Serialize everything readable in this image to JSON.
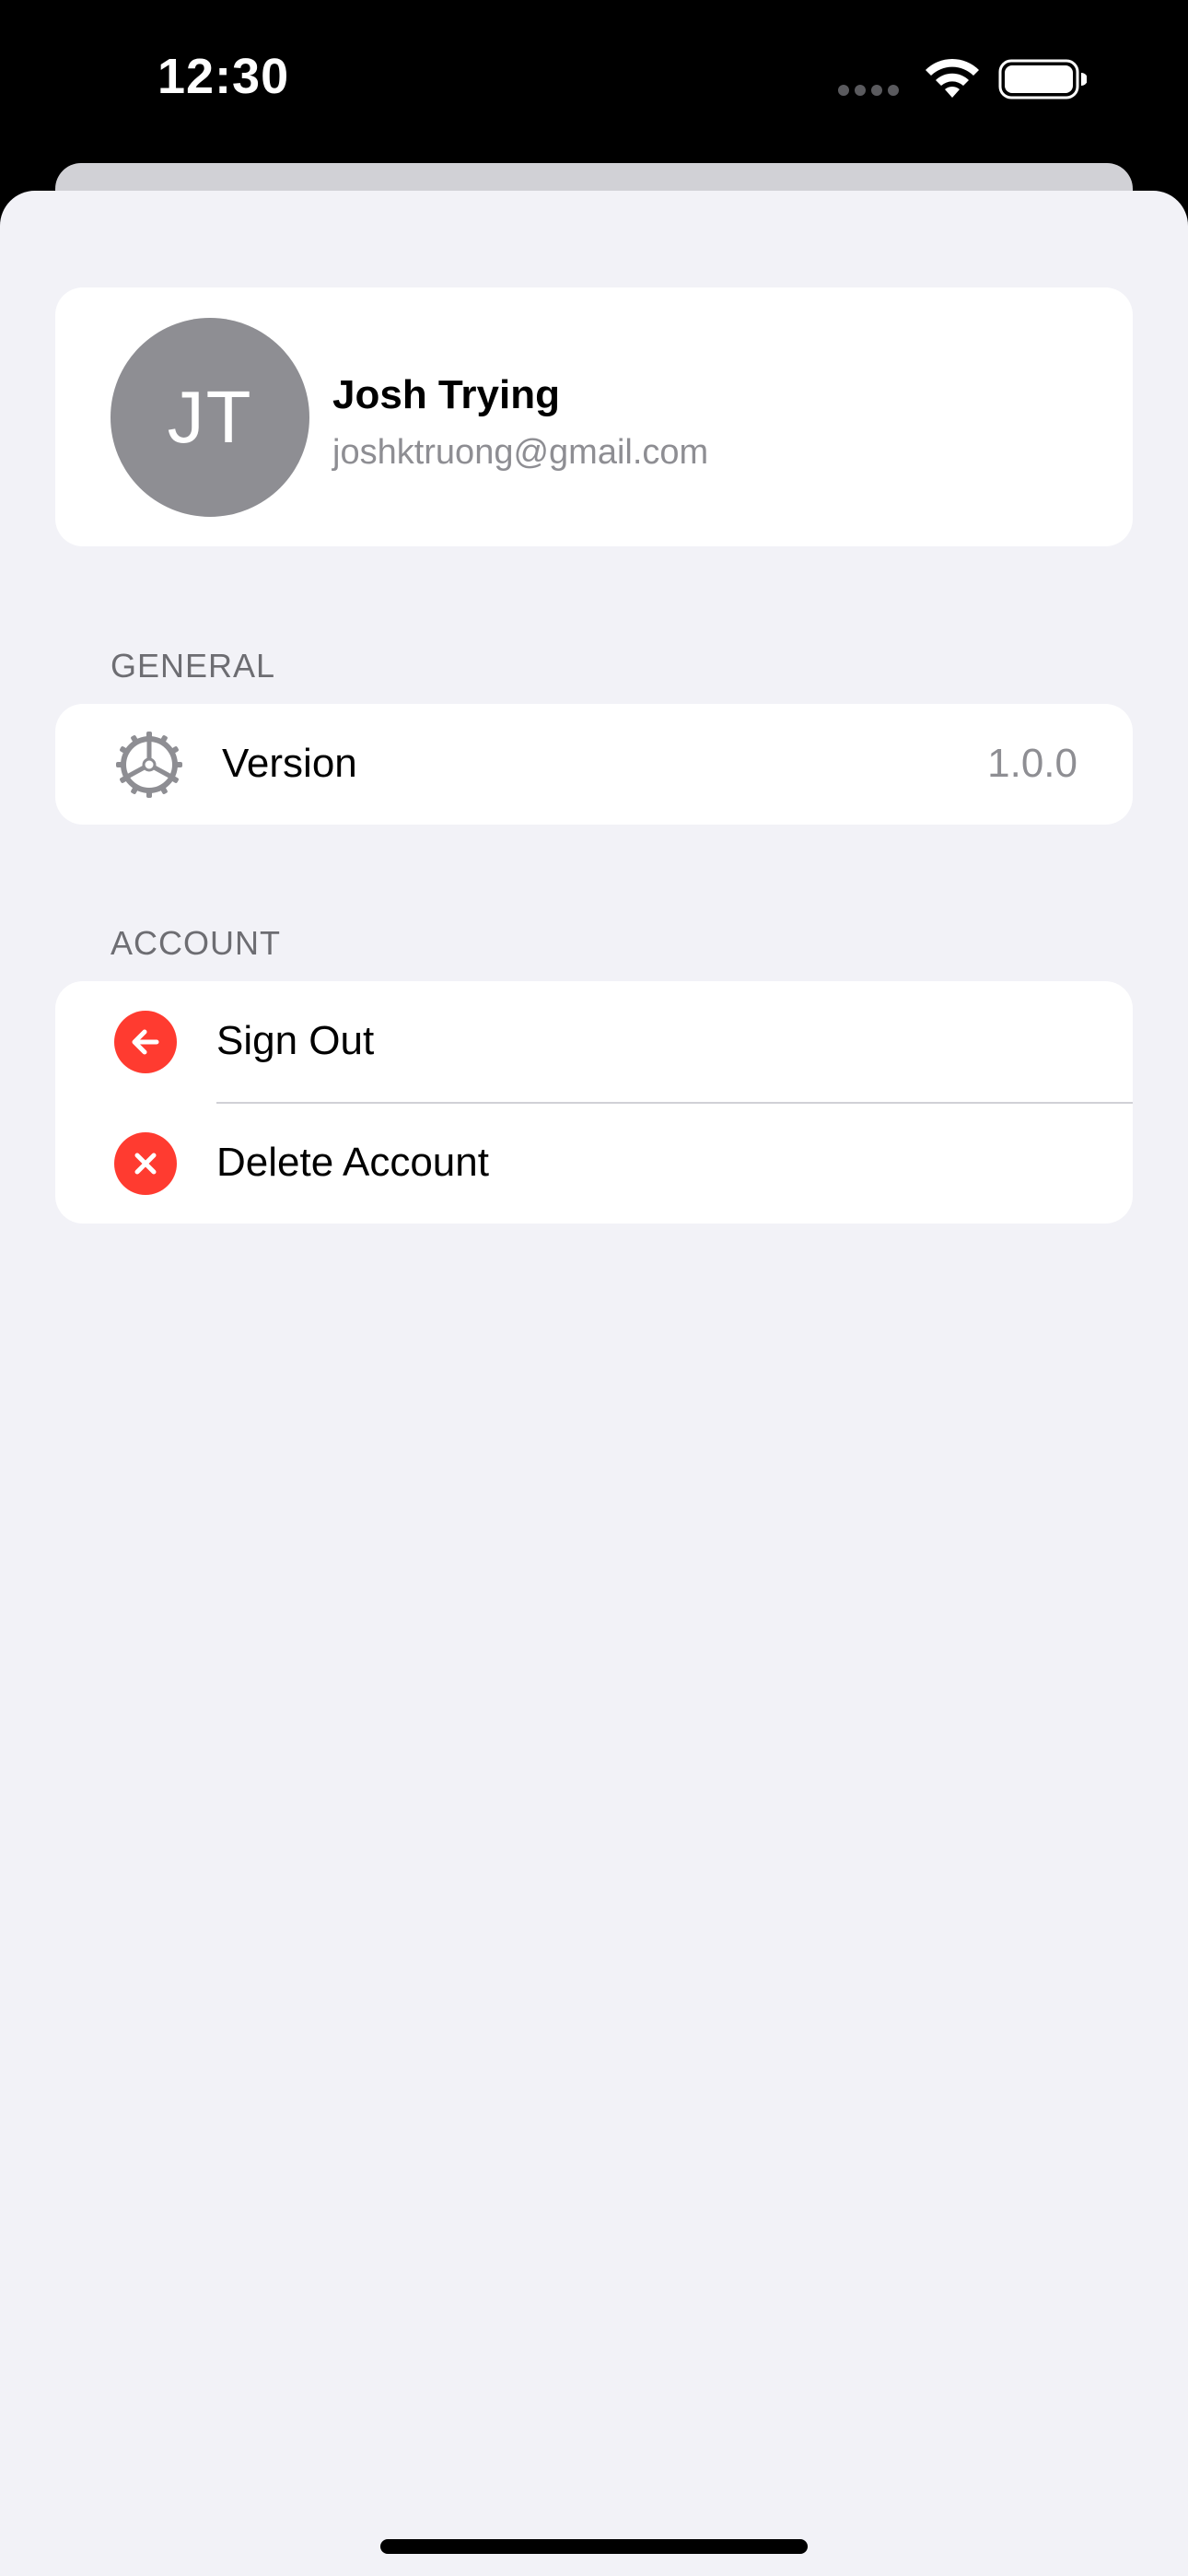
{
  "status_bar": {
    "time": "12:30",
    "signal_icon": "cellular-signal-icon",
    "wifi_icon": "wifi-icon",
    "battery_icon": "battery-full-icon"
  },
  "profile": {
    "initials": "JT",
    "name": "Josh Trying",
    "email": "joshktruong@gmail.com",
    "avatar_color": "#8e8e93"
  },
  "general": {
    "header": "GENERAL",
    "rows": [
      {
        "icon": "gear-icon",
        "label": "Version",
        "value": "1.0.0"
      }
    ]
  },
  "account": {
    "header": "ACCOUNT",
    "rows": [
      {
        "icon": "arrow-left-circle-icon",
        "label": "Sign Out"
      },
      {
        "icon": "x-circle-icon",
        "label": "Delete Account"
      }
    ]
  },
  "colors": {
    "background": "#f2f2f7",
    "card": "#ffffff",
    "destructive": "#ff3b30",
    "secondary_text": "#8e8e93"
  }
}
